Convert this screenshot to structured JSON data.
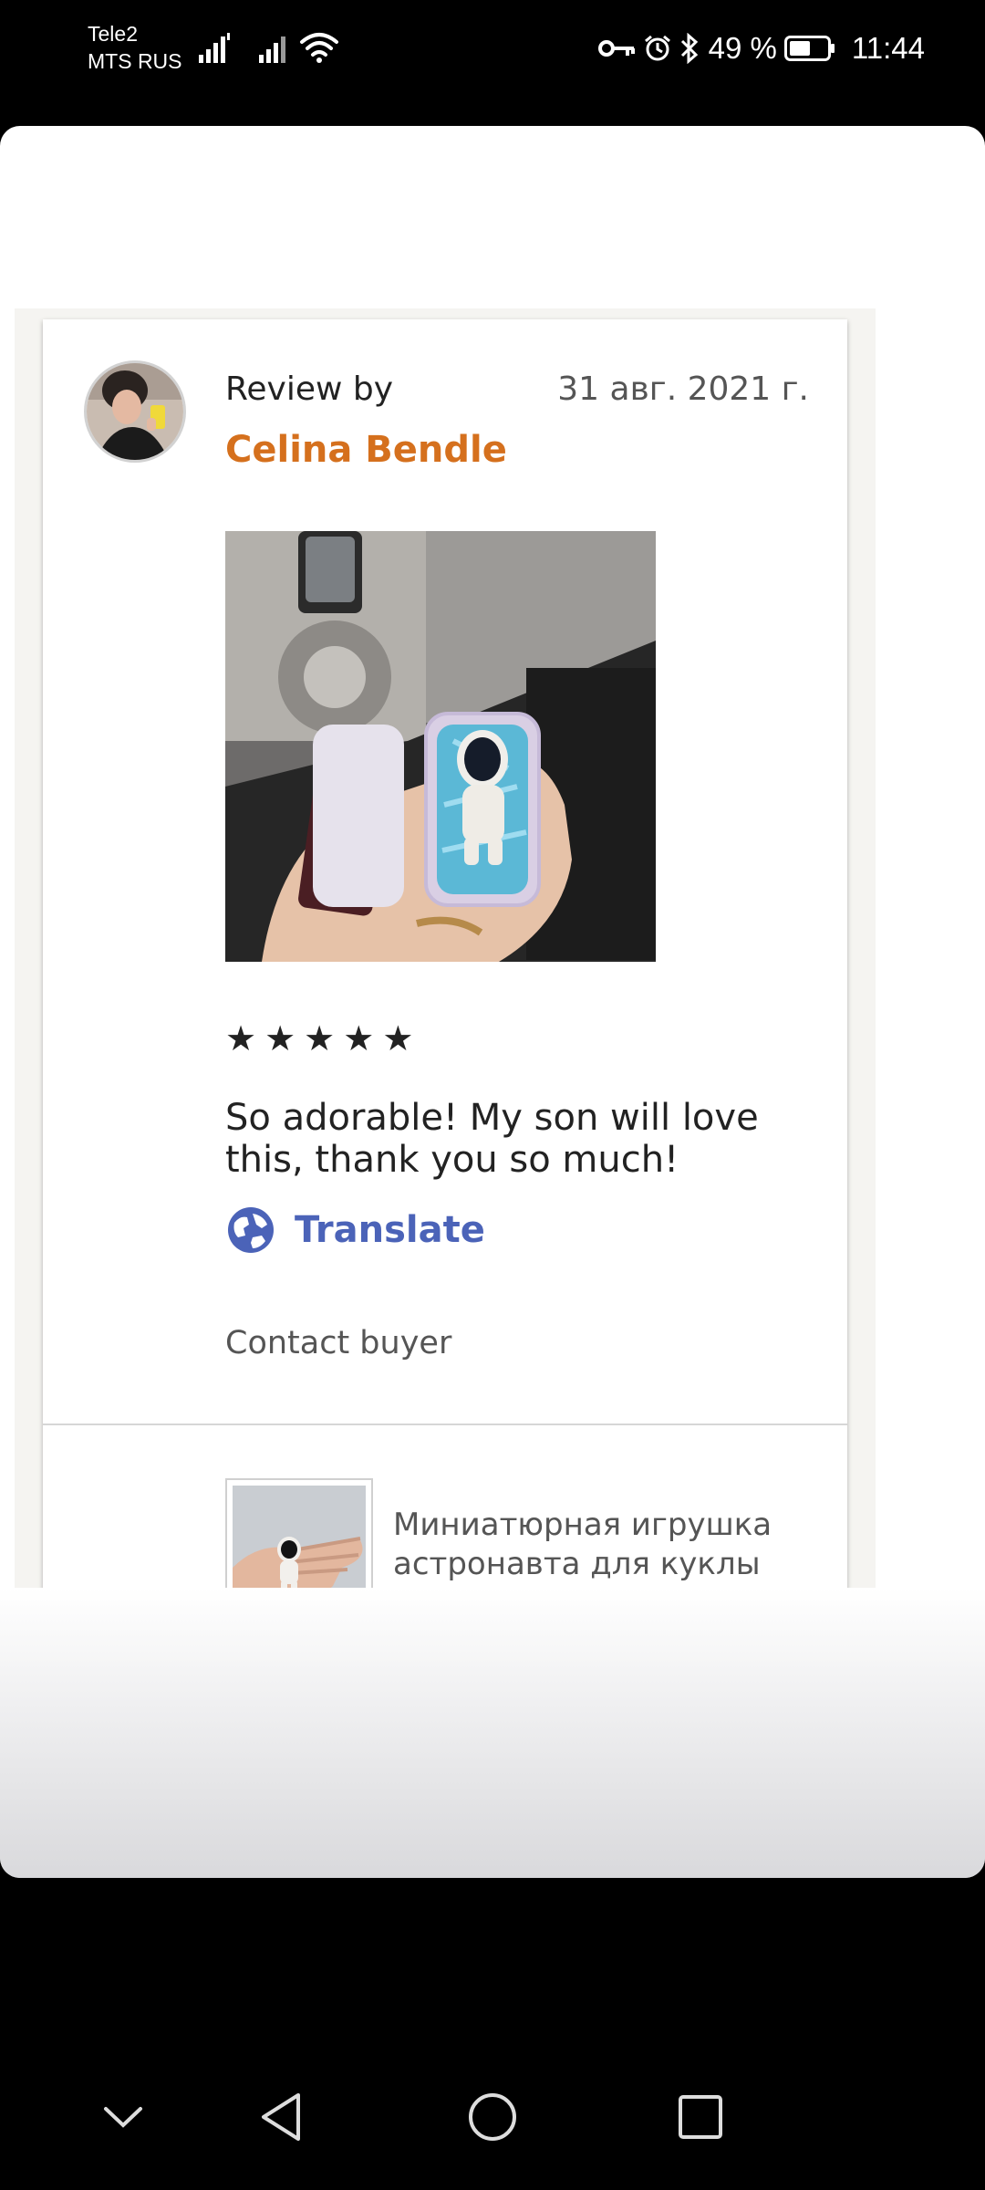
{
  "status_bar": {
    "carrier_1": "Tele2",
    "carrier_2": "MTS RUS",
    "battery": "49 %",
    "time": "11:44"
  },
  "review": {
    "heading": "Review by",
    "reviewer_name": "Celina Bendle",
    "date": "31 авг. 2021 г.",
    "rating": 5,
    "stars": [
      "★",
      "★",
      "★",
      "★",
      "★"
    ],
    "text": "So adorable! My son will love this, thank you so much!",
    "translate_label": "Translate",
    "contact_label": "Contact buyer"
  },
  "product": {
    "title": "Миниатюрная игрушка астронавта для куклы S..."
  },
  "colors": {
    "accent_name": "#d5701d",
    "link": "#4b63b8"
  }
}
